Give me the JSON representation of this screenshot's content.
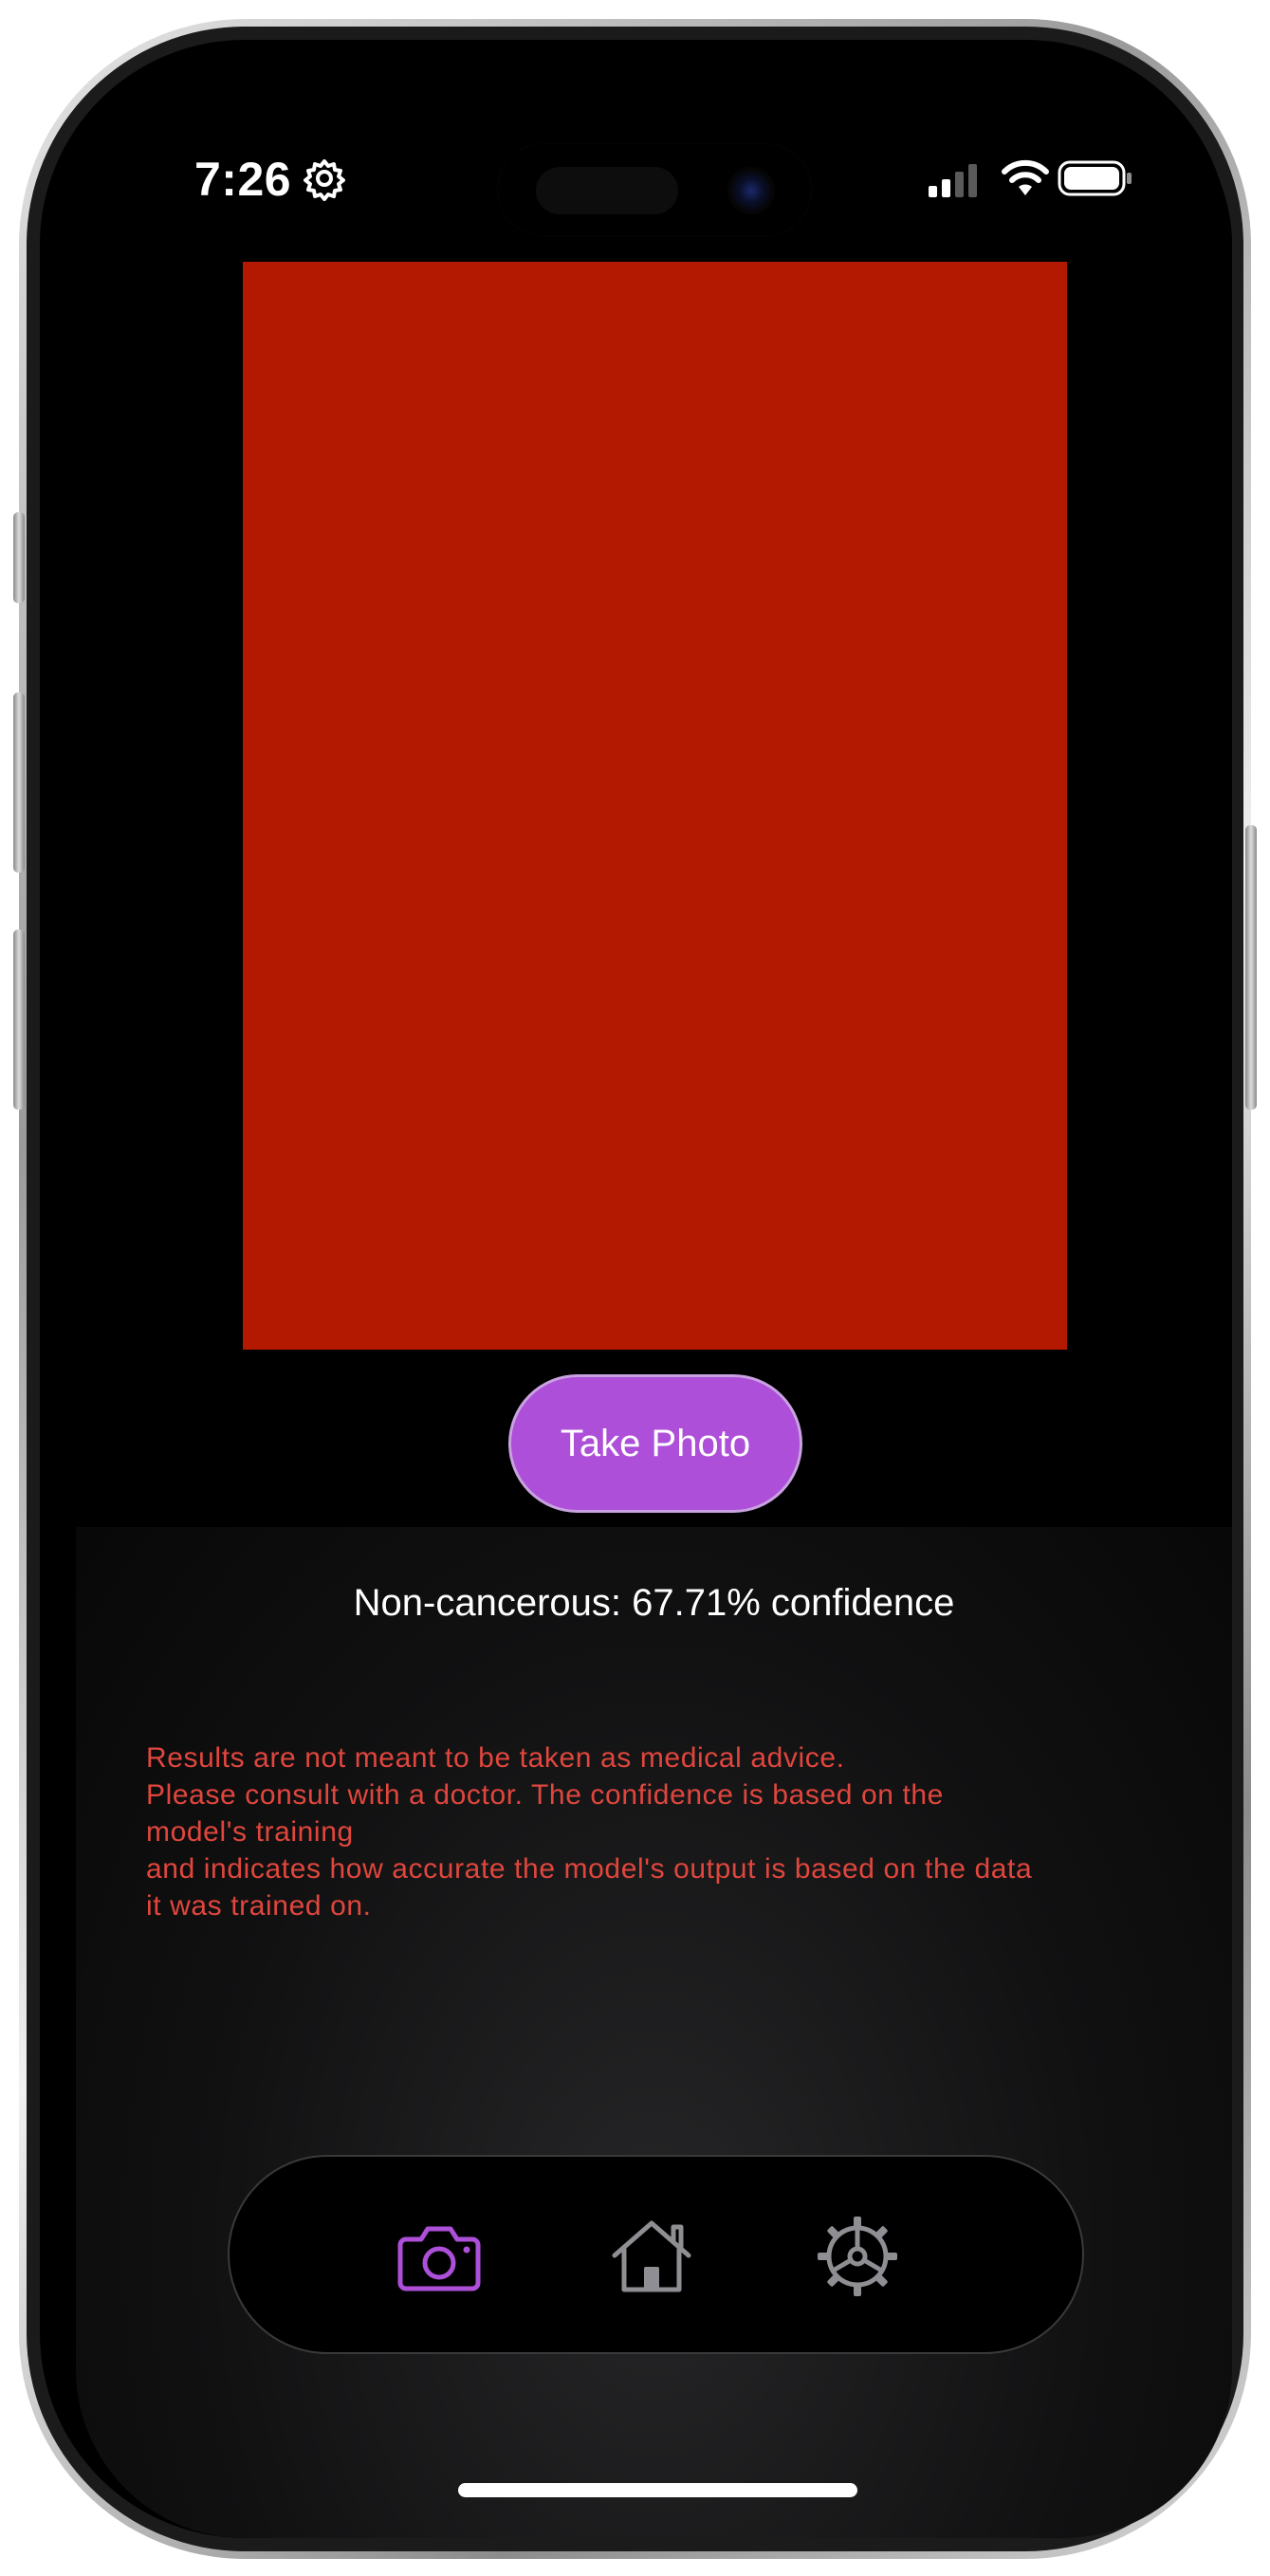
{
  "status_bar": {
    "time": "7:26",
    "icons": [
      "settings-gear-icon",
      "cellular-signal-icon",
      "wifi-icon",
      "battery-icon"
    ]
  },
  "camera_preview": {
    "color": "#b31800"
  },
  "take_photo_button": {
    "label": "Take Photo",
    "color": "#ad4fd9"
  },
  "result": {
    "text": "Non-cancerous: 67.71% confidence"
  },
  "disclaimer": {
    "color": "#e0463d",
    "lines": [
      "Results are not meant to be taken as medical advice.",
      "Please consult with a doctor. The confidence is based on the",
      "model's training",
      "and indicates how accurate the model's output is based on the data",
      "it was trained on."
    ]
  },
  "tab_bar": {
    "active_color": "#ad4fd9",
    "inactive_color": "#8e8e93",
    "tabs": [
      {
        "name": "camera",
        "icon": "camera-icon",
        "active": true
      },
      {
        "name": "home",
        "icon": "home-icon",
        "active": false
      },
      {
        "name": "settings",
        "icon": "gear-icon",
        "active": false
      }
    ]
  }
}
